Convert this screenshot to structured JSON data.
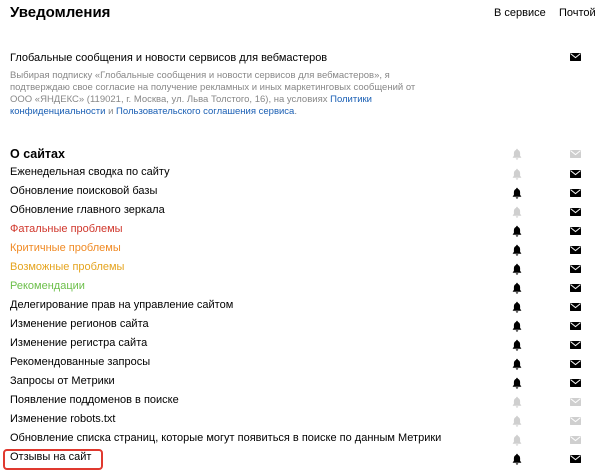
{
  "header": {
    "title": "Уведомления",
    "col_service": "В сервисе",
    "col_mail": "Почтой"
  },
  "global": {
    "title": "Глобальные сообщения и новости сервисов для вебмастеров",
    "desc_part1": "Выбирая подписку «Глобальные сообщения и новости сервисов для вебмастеров», я подтверждаю свое согласие на получение рекламных и иных маркетинговых сообщений от ООО «ЯНДЕКС» (119021, г. Москва, ул. Льва Толстого, 16), на условиях ",
    "link1": "Политики конфиденциальности",
    "desc_and": " и ",
    "link2": "Пользовательского соглашения сервиса",
    "desc_end": ".",
    "mail": "on"
  },
  "section": {
    "title": "О сайтах",
    "bell": "disabled",
    "mail": "disabled"
  },
  "rows": [
    {
      "label": "Еженедельная сводка по сайту",
      "color": "#000000",
      "bell": "disabled",
      "mail": "on"
    },
    {
      "label": "Обновление поисковой базы",
      "color": "#000000",
      "bell": "on",
      "mail": "on"
    },
    {
      "label": "Обновление главного зеркала",
      "color": "#000000",
      "bell": "disabled",
      "mail": "on"
    },
    {
      "label": "Фатальные проблемы",
      "color": "#d0372c",
      "bell": "on",
      "mail": "on"
    },
    {
      "label": "Критичные проблемы",
      "color": "#f08a24",
      "bell": "on",
      "mail": "on"
    },
    {
      "label": "Возможные проблемы",
      "color": "#e5a41f",
      "bell": "on",
      "mail": "on"
    },
    {
      "label": "Рекомендации",
      "color": "#6cbf4a",
      "bell": "on",
      "mail": "on"
    },
    {
      "label": "Делегирование прав на управление сайтом",
      "color": "#000000",
      "bell": "on",
      "mail": "on"
    },
    {
      "label": "Изменение регионов сайта",
      "color": "#000000",
      "bell": "on",
      "mail": "on"
    },
    {
      "label": "Изменение регистра сайта",
      "color": "#000000",
      "bell": "on",
      "mail": "on"
    },
    {
      "label": "Рекомендованные запросы",
      "color": "#000000",
      "bell": "on",
      "mail": "on"
    },
    {
      "label": "Запросы от Метрики",
      "color": "#000000",
      "bell": "on",
      "mail": "on"
    },
    {
      "label": "Появление поддоменов в поиске",
      "color": "#000000",
      "bell": "disabled",
      "mail": "disabled"
    },
    {
      "label": "Изменение robots.txt",
      "color": "#000000",
      "bell": "disabled",
      "mail": "disabled"
    },
    {
      "label": "Обновление списка страниц, которые могут появиться в поиске по данным Метрики",
      "color": "#000000",
      "bell": "disabled",
      "mail": "disabled"
    },
    {
      "label": "Отзывы на сайт",
      "color": "#000000",
      "bell": "on",
      "mail": "on"
    }
  ],
  "icons": {
    "bell": "bell-icon",
    "mail": "envelope-icon",
    "on_color": "#000000",
    "disabled_color": "#cfcfcf"
  },
  "highlight_color": "#e0392f"
}
